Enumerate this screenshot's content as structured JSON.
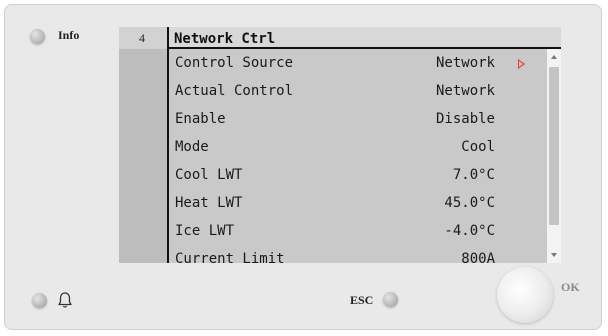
{
  "hardware": {
    "info_label": "Info",
    "esc_label": "ESC",
    "ok_label": "OK"
  },
  "screen": {
    "page_number": "4",
    "title": "Network Ctrl",
    "rows": [
      {
        "label": "Control Source",
        "value": "Network",
        "editable": true
      },
      {
        "label": "Actual Control",
        "value": "Network"
      },
      {
        "label": "Enable",
        "value": "Disable"
      },
      {
        "label": "Mode",
        "value": "Cool"
      },
      {
        "label": "Cool LWT",
        "value": "7.0°C"
      },
      {
        "label": "Heat LWT",
        "value": "45.0°C"
      },
      {
        "label": "Ice LWT",
        "value": "-4.0°C"
      },
      {
        "label": "Current Limit",
        "value": "800A"
      }
    ]
  },
  "icons": {
    "info_led": "led-icon",
    "alarm": "bell-icon",
    "esc_led": "led-icon",
    "ok_button": "knob-icon",
    "title_arrow": "play-arrow-icon",
    "row_arrow": "play-arrow-outline-icon"
  },
  "colors": {
    "screen_bg": "#c9c9c9",
    "title_arrow": "#3db24a",
    "edit_arrow": "#e23a3a"
  }
}
